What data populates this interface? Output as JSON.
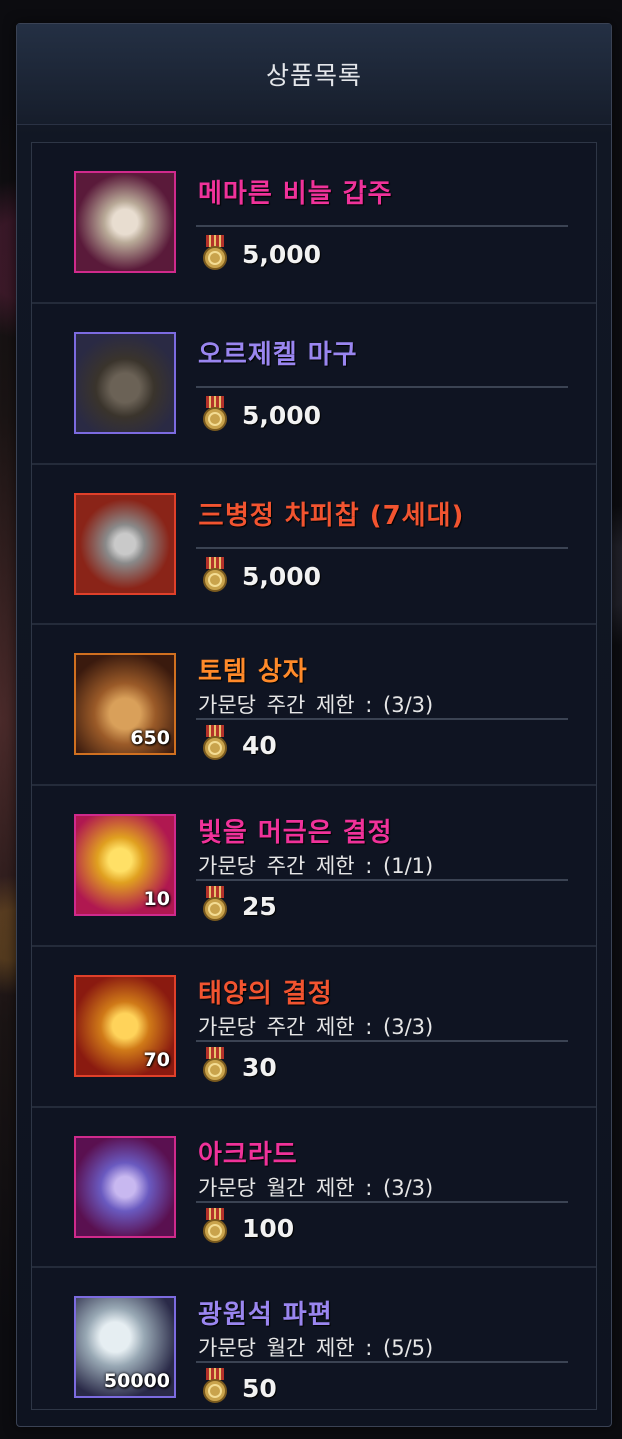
{
  "window": {
    "title": "상품목록"
  },
  "colors": {
    "pink": "#f0329a",
    "purple": "#9a86f0",
    "red": "#f25430",
    "orange": "#ff8a2a"
  },
  "items": [
    {
      "name": "메마른 비늘 갑주",
      "color": "#f0329a",
      "limit": "",
      "qty": "",
      "price": "5,000",
      "icon": "armor-icon",
      "frame": "#d02a8c"
    },
    {
      "name": "오르제켈 마구",
      "color": "#9a86f0",
      "limit": "",
      "qty": "",
      "price": "5,000",
      "icon": "horse-armor-icon",
      "frame": "#7c6be0"
    },
    {
      "name": "三병정 차피찹 (7세대)",
      "color": "#f25430",
      "limit": "",
      "qty": "",
      "price": "5,000",
      "icon": "rabbit-pet-icon",
      "frame": "#e0402a"
    },
    {
      "name": "토템 상자",
      "color": "#ff8a2a",
      "limit": "가문당 주간 제한 : (3/3)",
      "qty": "650",
      "price": "40",
      "icon": "totem-box-icon",
      "frame": "#d07020"
    },
    {
      "name": "빛을 머금은 결정",
      "color": "#f0329a",
      "limit": "가문당 주간 제한 : (1/1)",
      "qty": "10",
      "price": "25",
      "icon": "crystal-icon",
      "frame": "#d02a8c"
    },
    {
      "name": "태양의 결정",
      "color": "#f25430",
      "limit": "가문당 주간 제한 : (3/3)",
      "qty": "70",
      "price": "30",
      "icon": "sun-crystal-icon",
      "frame": "#e0402a"
    },
    {
      "name": "아크라드",
      "color": "#f0329a",
      "limit": "가문당 월간 제한 : (3/3)",
      "qty": "",
      "price": "100",
      "icon": "ore-icon",
      "frame": "#d02a8c"
    },
    {
      "name": "광원석 파편",
      "color": "#9a86f0",
      "limit": "가문당 월간 제한 : (5/5)",
      "qty": "50000",
      "price": "50",
      "icon": "ore-shard-icon",
      "frame": "#7c6be0"
    }
  ],
  "currency_icon": "medal-icon"
}
